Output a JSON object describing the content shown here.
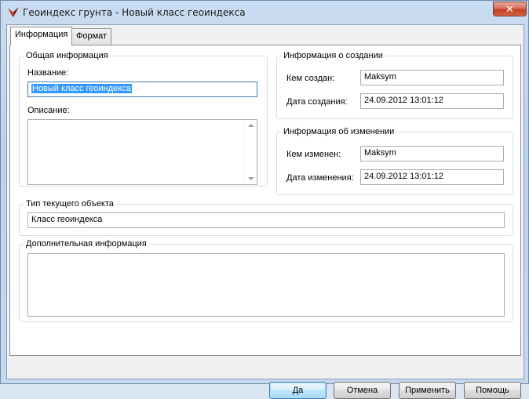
{
  "window": {
    "title": "Геоиндекс грунта  - Новый класс геоиндекса",
    "close_glyph": "✕"
  },
  "tabs": [
    {
      "label": "Информация",
      "active": true
    },
    {
      "label": "Формат",
      "active": false
    }
  ],
  "general": {
    "legend": "Общая информация",
    "name_label": "Название:",
    "name_value": "Новый класс геоиндекса",
    "desc_label": "Описание:",
    "desc_value": ""
  },
  "created": {
    "legend": "Информация о создании",
    "by_label": "Кем создан:",
    "by_value": "Maksym",
    "date_label": "Дата создания:",
    "date_value": "24.09.2012 13:01:12"
  },
  "modified": {
    "legend": "Информация об изменении",
    "by_label": "Кем изменен:",
    "by_value": "Maksym",
    "date_label": "Дата изменения:",
    "date_value": "24.09.2012 13:01:12"
  },
  "object_type": {
    "legend": "Тип текущего объекта",
    "value": "Класс геоиндекса"
  },
  "additional": {
    "legend": "Дополнительная информация",
    "value": ""
  },
  "buttons": {
    "ok": "Да",
    "cancel": "Отмена",
    "apply": "Применить",
    "help": "Помощь"
  },
  "icons": {
    "app": "red-bird-app-icon",
    "close": "close-icon",
    "scroll_up": "scroll-up-arrow-icon",
    "scroll_down": "scroll-down-arrow-icon"
  },
  "colors": {
    "selection": "#3399ff",
    "close_button": "#c23f21",
    "default_button": "#3c7fb1"
  }
}
